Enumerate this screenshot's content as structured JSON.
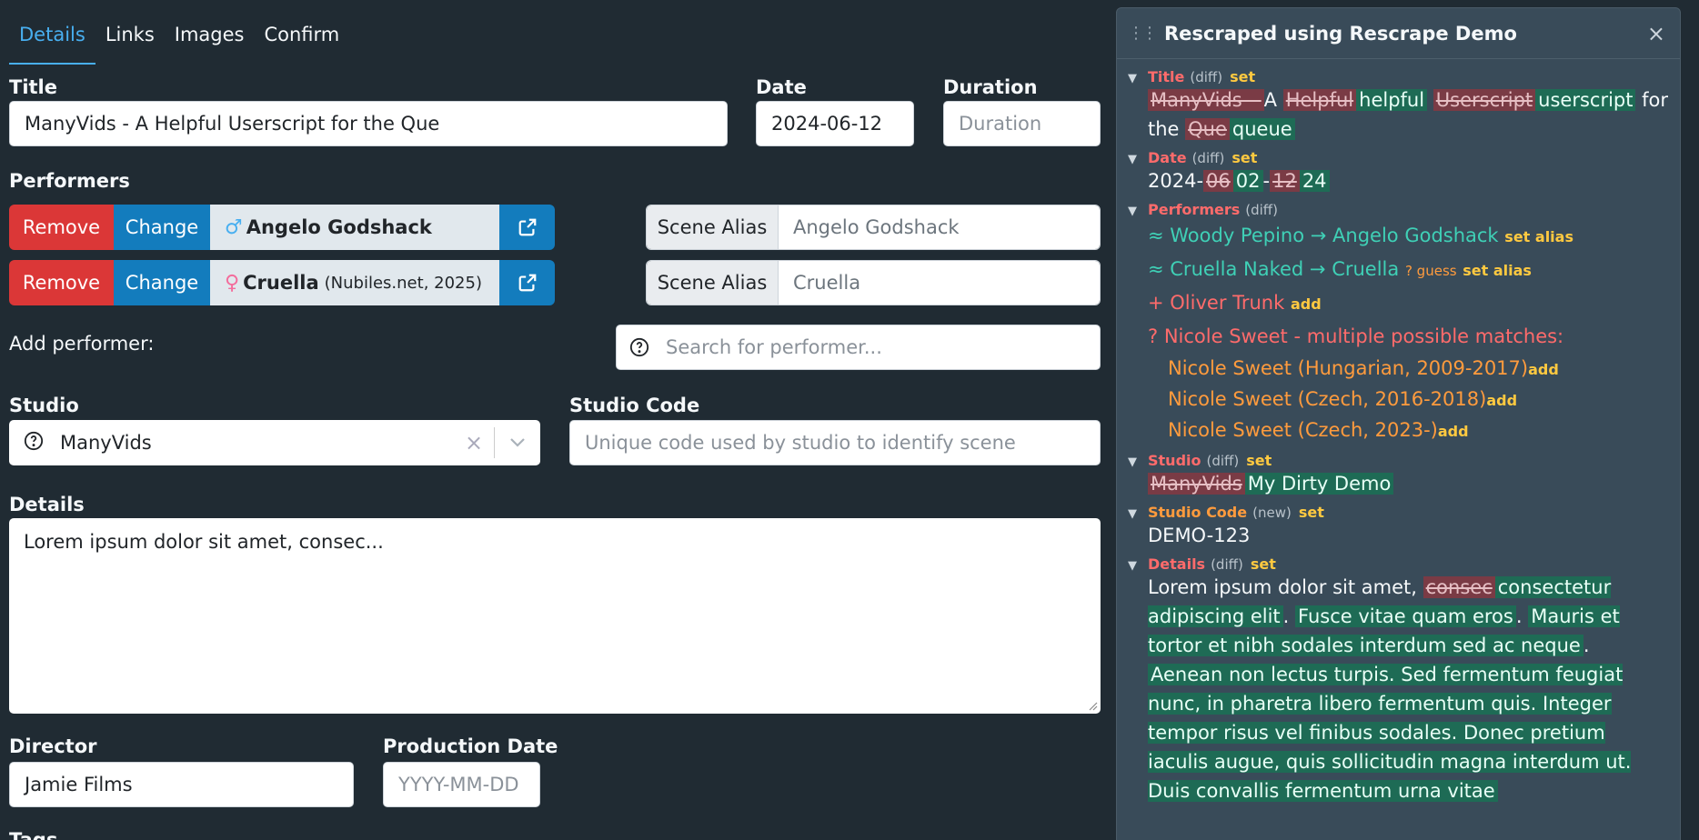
{
  "tabs": [
    {
      "label": "Details",
      "active": true
    },
    {
      "label": "Links",
      "active": false
    },
    {
      "label": "Images",
      "active": false
    },
    {
      "label": "Confirm",
      "active": false
    }
  ],
  "title": {
    "label": "Title",
    "value": "ManyVids - A Helpful Userscript for the Que"
  },
  "date": {
    "label": "Date",
    "value": "2024-06-12"
  },
  "duration": {
    "label": "Duration",
    "placeholder": "Duration"
  },
  "performers": {
    "label": "Performers",
    "remove_label": "Remove",
    "change_label": "Change",
    "alias_label": "Scene Alias",
    "items": [
      {
        "name": "Angelo Godshack",
        "extra": "",
        "gender_icon": "male-icon",
        "alias": "Angelo Godshack"
      },
      {
        "name": "Cruella",
        "extra": "(Nubiles.net, 2025)",
        "gender_icon": "female-icon",
        "alias": "Cruella"
      }
    ],
    "add_label": "Add performer:",
    "search_placeholder": "Search for performer..."
  },
  "studio": {
    "label": "Studio",
    "value": "ManyVids"
  },
  "studio_code": {
    "label": "Studio Code",
    "placeholder": "Unique code used by studio to identify scene"
  },
  "details": {
    "label": "Details",
    "value": "Lorem ipsum dolor sit amet, consec..."
  },
  "director": {
    "label": "Director",
    "value": "Jamie Films"
  },
  "production_date": {
    "label": "Production Date",
    "placeholder": "YYYY-MM-DD"
  },
  "tags_label": "Tags",
  "panel": {
    "title": "Rescraped using Rescrape Demo",
    "close": "×",
    "diff_tag": "(diff)",
    "new_tag": "(new)",
    "set_label": "set",
    "title_sec": {
      "name": "Title",
      "parts": [
        {
          "t": "ManyVids - ",
          "k": "del"
        },
        {
          "t": "A ",
          "k": ""
        },
        {
          "t": "Helpful",
          "k": "del"
        },
        {
          "t": "helpful",
          "k": "ins"
        },
        {
          "t": " ",
          "k": ""
        },
        {
          "t": "Userscript",
          "k": "del"
        },
        {
          "t": "userscript",
          "k": "ins"
        },
        {
          "t": " for the ",
          "k": ""
        },
        {
          "t": "Que",
          "k": "del"
        },
        {
          "t": "queue",
          "k": "ins"
        }
      ]
    },
    "date_sec": {
      "name": "Date",
      "parts": [
        {
          "t": "2024-",
          "k": ""
        },
        {
          "t": "06",
          "k": "del"
        },
        {
          "t": "02",
          "k": "ins"
        },
        {
          "t": "-",
          "k": ""
        },
        {
          "t": "12",
          "k": "del"
        },
        {
          "t": "24",
          "k": "ins"
        }
      ]
    },
    "performers_sec": {
      "name": "Performers",
      "rename1": "≈ Woody Pepino → Angelo Godshack",
      "rename2": "≈ Cruella Naked → Cruella",
      "set_alias": "set alias",
      "guess": "? guess",
      "add_new": "+ Oliver Trunk",
      "add": "add",
      "multi": "? Nicole Sweet - multiple possible matches:",
      "matches": [
        {
          "name": "Nicole Sweet",
          "info": "(Hungarian, 2009-2017)"
        },
        {
          "name": "Nicole Sweet",
          "info": "(Czech, 2016-2018)"
        },
        {
          "name": "Nicole Sweet",
          "info": "(Czech, 2023-)"
        }
      ]
    },
    "studio_sec": {
      "name": "Studio",
      "old": "ManyVids",
      "new": "My Dirty Demo"
    },
    "code_sec": {
      "name": "Studio Code",
      "value": "DEMO-123"
    },
    "details_sec": {
      "name": "Details",
      "parts": [
        {
          "t": "Lorem ipsum dolor sit amet, ",
          "k": ""
        },
        {
          "t": "consec",
          "k": "del"
        },
        {
          "t": "consectetur adipiscing elit",
          "k": "ins"
        },
        {
          "t": ". ",
          "k": ""
        },
        {
          "t": "Fusce vitae quam eros",
          "k": "ins"
        },
        {
          "t": ". ",
          "k": ""
        },
        {
          "t": "Mauris et tortor et nibh sodales interdum sed ac neque",
          "k": "ins"
        },
        {
          "t": ". ",
          "k": ""
        },
        {
          "t": "Aenean non lectus turpis. Sed fermentum feugiat nunc, in pharetra libero fermentum quis. Integer tempor risus vel finibus sodales. Donec pretium iaculis augue, quis sollicitudin magna interdum ut. Duis convallis fermentum urna vitae",
          "k": "ins"
        }
      ]
    }
  }
}
